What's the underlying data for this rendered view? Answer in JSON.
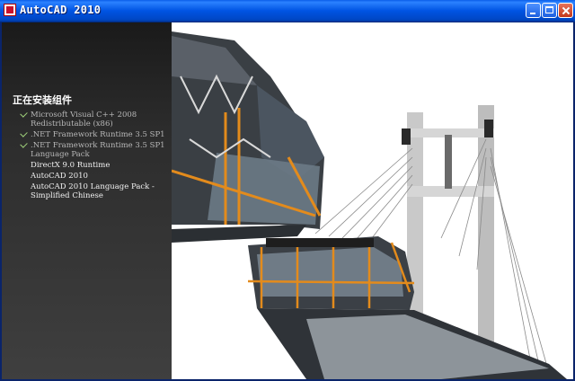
{
  "window": {
    "title": "AutoCAD 2010",
    "controls": {
      "minimize": "minimize",
      "maximize": "maximize",
      "close": "close"
    }
  },
  "side_panel": {
    "header": "正在安装组件",
    "components": [
      {
        "label": "Microsoft Visual C++ 2008 Redistributable (x86)",
        "status": "done"
      },
      {
        "label": ".NET Framework Runtime 3.5 SP1",
        "status": "done"
      },
      {
        "label": ".NET Framework Runtime 3.5 SP1 Language Pack",
        "status": "done"
      },
      {
        "label": "DirectX 9.0 Runtime",
        "status": "pending"
      },
      {
        "label": "AutoCAD 2010",
        "status": "pending"
      },
      {
        "label": "AutoCAD 2010 Language Pack - Simplified Chinese",
        "status": "pending"
      }
    ]
  },
  "colors": {
    "titlebar": "#0054e3",
    "panel": "#2c2c2c",
    "scaffold": "#e38b1c",
    "tower": "#c9c9c9"
  }
}
